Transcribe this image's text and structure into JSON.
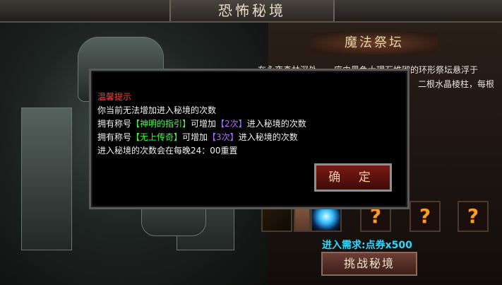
{
  "window": {
    "title": "恐怖秘境"
  },
  "panel": {
    "header": "魔法祭坛",
    "desc_line1": "在永夜森林深处，一座由黑色大理石堆砌的环形祭坛悬浮于",
    "desc_line2": "二根水晶棱柱，每根"
  },
  "dialog": {
    "title": "温馨提示",
    "line1": "你当前无法增加进入秘境的次数",
    "line2_prefix": "拥有称号",
    "line2_title": "【神明的指引】",
    "line2_mid": "可增加",
    "line2_count": "【2次】",
    "line2_suffix": "进入秘境的次数",
    "line3_prefix": "拥有称号",
    "line3_title": "【无上传奇】",
    "line3_mid": "可增加",
    "line3_count": "【3次】",
    "line3_suffix": "进入秘境的次数",
    "line4": "进入秘境的次数会在每晚24：00重置",
    "ok_label": "确 定"
  },
  "rewards": {
    "slots": [
      {
        "icon": "golden-feather-icon"
      },
      {
        "icon": "parchment-icon"
      },
      {
        "icon": "blue-burst-icon"
      },
      {
        "icon": "question-mark-icon",
        "label": "?"
      },
      {
        "icon": "question-mark-icon",
        "label": "?"
      },
      {
        "icon": "question-mark-icon",
        "label": "?"
      }
    ]
  },
  "requirement": "进入需求:点券x500",
  "challenge_button": "挑战秘境",
  "colors": {
    "dialog_title": "#ff3b3b",
    "title_highlight": "#39ff39",
    "count_highlight": "#b36bff",
    "requirement": "#29d9ff",
    "question_mark": "#ff9a1a"
  }
}
